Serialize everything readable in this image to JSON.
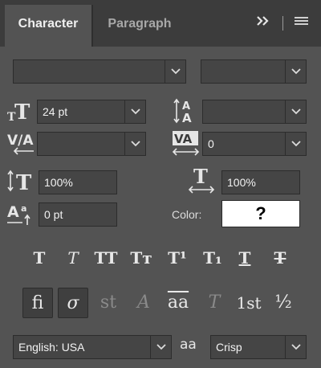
{
  "tabs": {
    "character": "Character",
    "paragraph": "Paragraph"
  },
  "toolbar": {
    "expand_icon": "»",
    "menu_icon": "menu"
  },
  "font": {
    "family": "",
    "style": ""
  },
  "size": {
    "font_size": "24 pt",
    "leading": ""
  },
  "spacing": {
    "kerning": "",
    "tracking": "0"
  },
  "scale": {
    "vertical": "100%",
    "horizontal": "100%"
  },
  "baseline": {
    "shift": "0 pt"
  },
  "color": {
    "label": "Color:",
    "value": "?"
  },
  "styles": [
    {
      "name": "faux-bold",
      "glyph": "T"
    },
    {
      "name": "faux-italic",
      "glyph": "T"
    },
    {
      "name": "all-caps",
      "glyph": "TT"
    },
    {
      "name": "small-caps",
      "glyph": "Tт"
    },
    {
      "name": "superscript",
      "glyph": "T¹"
    },
    {
      "name": "subscript",
      "glyph": "T₁"
    },
    {
      "name": "underline",
      "glyph": "T"
    },
    {
      "name": "strikethrough",
      "glyph": "T"
    }
  ],
  "opentype": [
    {
      "name": "ligatures",
      "glyph": "fi",
      "state": "on"
    },
    {
      "name": "swash",
      "glyph": "σ",
      "state": "on"
    },
    {
      "name": "discretionary-ligatures",
      "glyph": "st",
      "state": "dim"
    },
    {
      "name": "contextual-alternates",
      "glyph": "A",
      "state": "dim"
    },
    {
      "name": "titling-alternates",
      "glyph": "aa",
      "state": "normal"
    },
    {
      "name": "stylistic-alternates",
      "glyph": "T",
      "state": "dim"
    },
    {
      "name": "ordinals",
      "glyph": "1st",
      "state": "normal"
    },
    {
      "name": "fractions",
      "glyph": "½",
      "state": "normal"
    }
  ],
  "language": {
    "value": "English: USA"
  },
  "antialias": {
    "icon": "aa",
    "value": "Crisp"
  },
  "colors": {
    "panel": "#535353",
    "tabbar": "#3c3c3c",
    "field": "#454545"
  }
}
